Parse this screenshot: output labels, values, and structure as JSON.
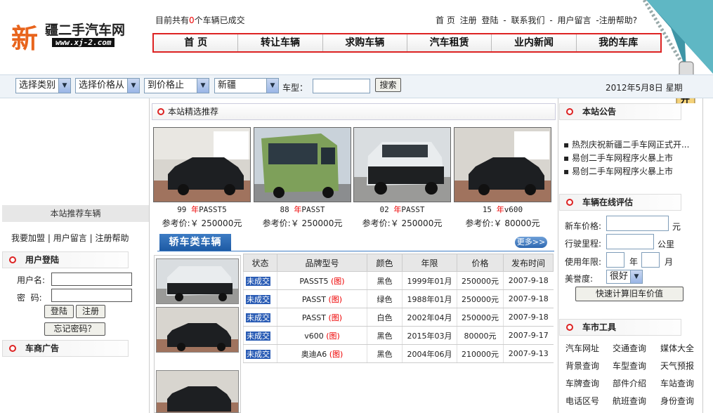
{
  "logo": {
    "char": "新",
    "name": "疆二手汽车网",
    "url": "www.xj-2.com"
  },
  "deal_info": {
    "prefix": "目前共有",
    "count": "0",
    "suffix": "个车辆已成交"
  },
  "top_links": [
    "首 页",
    "注册",
    "登陆",
    "-",
    "联系我们",
    "-",
    "用户留言",
    "-注册帮助?"
  ],
  "nav": [
    "首 页",
    "转让车辆",
    "求购车辆",
    "汽车租赁",
    "业内新闻",
    "我的车库"
  ],
  "zipper_label": "打开",
  "search": {
    "category": "选择类别",
    "price_from": "选择价格从",
    "price_to": "到价格止",
    "region": "新疆",
    "cartype_label": "车型：",
    "cartype_value": "",
    "submit": "搜索",
    "date": "2012年5月8日  星期"
  },
  "left": {
    "recommend_title": "本站推荐车辆",
    "links": [
      "我要加盟",
      "|",
      "用户留言",
      "|",
      "注册帮助"
    ],
    "login": {
      "title": "用户登陆",
      "user_label": "用户名:",
      "pass_label": "密  码:",
      "login_btn": "登陆",
      "register_btn": "注册",
      "forgot_btn": "忘记密码？"
    },
    "ads_title": "车商广告"
  },
  "featured": {
    "title": "本站精选推荐",
    "cars": [
      {
        "year": "99",
        "yearword": "年",
        "model": "PASST5",
        "price": "参考价:￥ 250000元"
      },
      {
        "year": "88",
        "yearword": "年",
        "model": "PASST",
        "price": "参考价:￥ 250000元"
      },
      {
        "year": "02",
        "yearword": "年",
        "model": "PASST",
        "price": "参考价:￥ 250000元"
      },
      {
        "year": "15",
        "yearword": "年",
        "model": "v600",
        "price": "参考价:￥ 80000元"
      }
    ]
  },
  "sedan": {
    "title": "轿车类车辆",
    "more": "更多>>",
    "columns": [
      "状态",
      "品牌型号",
      "颜色",
      "年限",
      "价格",
      "发布时间"
    ],
    "rows": [
      {
        "status": "未成交",
        "model": "PASST5",
        "tu": "(图)",
        "color": "黑色",
        "year": "1999年01月",
        "price": "250000元",
        "date": "2007-9-18"
      },
      {
        "status": "未成交",
        "model": "PASST",
        "tu": "(图)",
        "color": "绿色",
        "year": "1988年01月",
        "price": "250000元",
        "date": "2007-9-18"
      },
      {
        "status": "未成交",
        "model": "PASST",
        "tu": "(图)",
        "color": "白色",
        "year": "2002年04月",
        "price": "250000元",
        "date": "2007-9-18"
      },
      {
        "status": "未成交",
        "model": "v600",
        "tu": "(图)",
        "color": "黑色",
        "year": "2015年03月",
        "price": "80000元",
        "date": "2007-9-17"
      },
      {
        "status": "未成交",
        "model": "奥迪A6",
        "tu": "(图)",
        "color": "黑色",
        "year": "2004年06月",
        "price": "210000元",
        "date": "2007-9-13"
      }
    ]
  },
  "right": {
    "notice_title": "本站公告",
    "notices": [
      "热烈庆祝新疆二手车网正式开...",
      "易创二手车网程序火暴上市",
      "易创二手车网程序火暴上市"
    ],
    "eval_title": "车辆在线评估",
    "new_price_label": "新车价格:",
    "new_price_unit": "元",
    "mileage_label": "行驶里程:",
    "mileage_unit": "公里",
    "years_label": "使用年限:",
    "year_unit": "年",
    "month_unit": "月",
    "condition_label": "美誉度:",
    "condition_value": "很好",
    "calc_btn": "快速计算旧车价值",
    "tools_title": "车市工具",
    "tools": [
      "汽车网址",
      "交通查询",
      "媒体大全",
      "背景查询",
      "车型查询",
      "天气预报",
      "车牌查询",
      "部件介绍",
      "车站查询",
      "电话区号",
      "航班查询",
      "身份查询"
    ]
  },
  "colors": {
    "accent_red": "#dd2222",
    "nav_blue": "#2a5cb5"
  }
}
